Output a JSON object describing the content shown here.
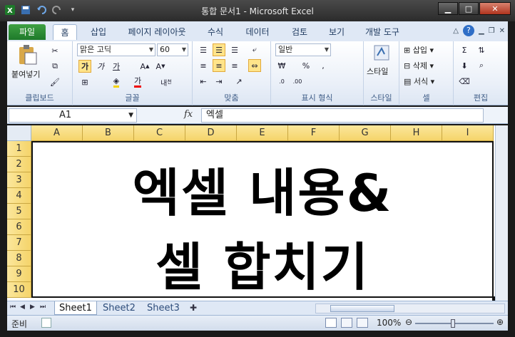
{
  "window": {
    "title": "통합 문서1 - Microsoft Excel"
  },
  "tabs": [
    "파일",
    "홈",
    "삽입",
    "페이지 레이아웃",
    "수식",
    "데이터",
    "검토",
    "보기",
    "개발 도구"
  ],
  "ribbon": {
    "clipboard": {
      "label": "클립보드",
      "paste_label": "붙여넣기"
    },
    "font": {
      "label": "글꼴",
      "font_name": "맑은 고딕",
      "font_size": "60",
      "bold": "가",
      "italic": "가",
      "underline": "가"
    },
    "alignment": {
      "label": "맞춤"
    },
    "number": {
      "label": "표시 형식",
      "format": "일반"
    },
    "styles": {
      "label": "스타일",
      "style_label": "스타일"
    },
    "cells": {
      "label": "셀",
      "insert_label": "삽입",
      "delete_label": "삭제",
      "format_label": "서식"
    },
    "editing": {
      "label": "편집"
    }
  },
  "formula_bar": {
    "name_box": "A1",
    "fx": "fx",
    "content": "엑셀"
  },
  "columns": [
    "A",
    "B",
    "C",
    "D",
    "E",
    "F",
    "G",
    "H",
    "I"
  ],
  "rows": [
    "1",
    "2",
    "3",
    "4",
    "5",
    "6",
    "7",
    "8",
    "9",
    "10"
  ],
  "cell": {
    "line1": "엑셀 내용&",
    "line2": "셀 합치기"
  },
  "sheets": [
    "Sheet1",
    "Sheet2",
    "Sheet3"
  ],
  "status": {
    "mode": "준비",
    "zoom": "100%"
  }
}
